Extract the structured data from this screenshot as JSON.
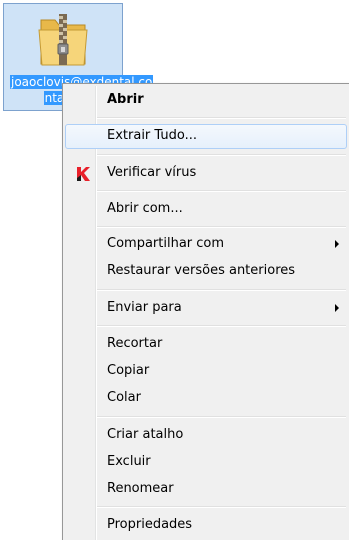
{
  "desktop_icon": {
    "label_line1": "joaoclovis@exdental.co",
    "label_line2": "ntal.co"
  },
  "context_menu": {
    "items": [
      {
        "label": "Abrir"
      },
      {
        "label": "Extrair Tudo..."
      },
      {
        "label": "Verificar vírus",
        "icon": "kaspersky-icon"
      },
      {
        "label": "Abrir com..."
      },
      {
        "label": "Compartilhar com",
        "submenu": true
      },
      {
        "label": "Restaurar versões anteriores"
      },
      {
        "label": "Enviar para",
        "submenu": true
      },
      {
        "label": "Recortar"
      },
      {
        "label": "Copiar"
      },
      {
        "label": "Colar"
      },
      {
        "label": "Criar atalho"
      },
      {
        "label": "Excluir"
      },
      {
        "label": "Renomear"
      },
      {
        "label": "Propriedades"
      }
    ]
  },
  "colors": {
    "selection": "#3399ff",
    "icon_highlight": "#cfe3f7",
    "menu_background": "#f0f0f0",
    "hover_border": "#aecff7",
    "kaspersky_red": "#e8202a"
  }
}
